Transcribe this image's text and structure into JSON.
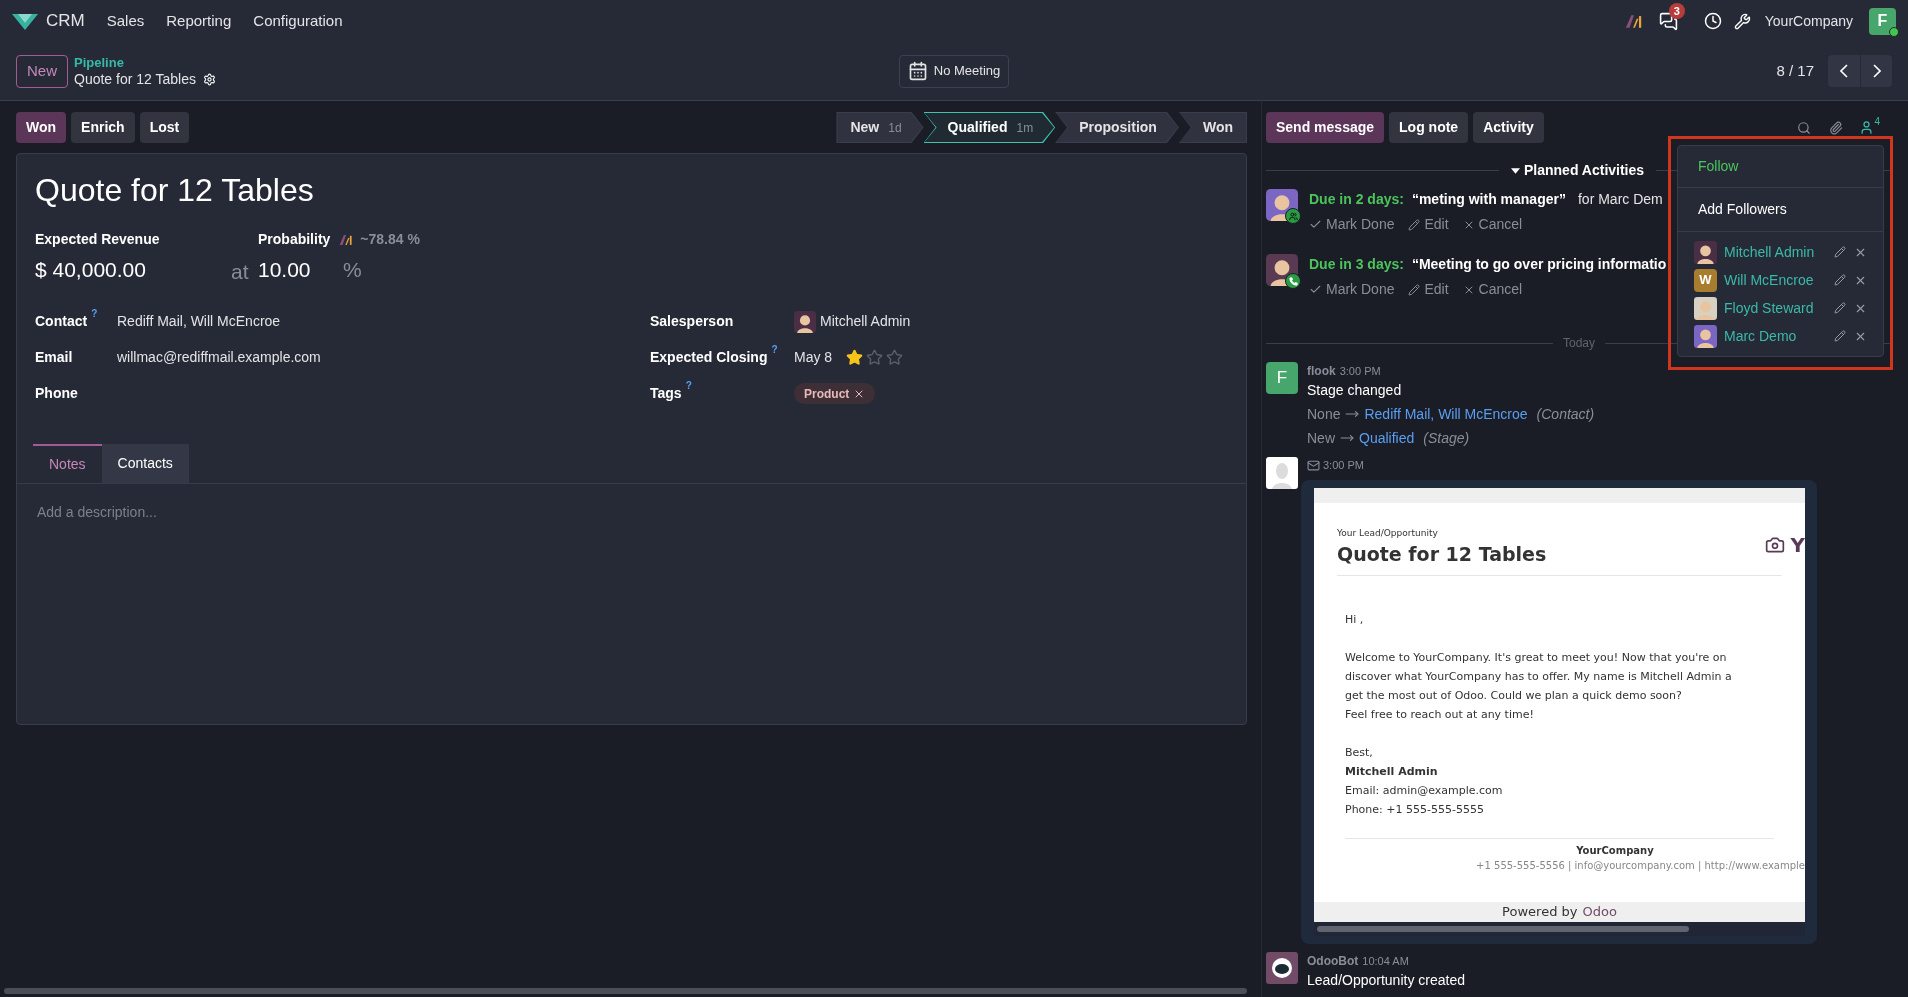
{
  "navbar": {
    "app": "CRM",
    "menus": [
      "Sales",
      "Reporting",
      "Configuration"
    ],
    "messages_badge": "3",
    "company": "YourCompany",
    "avatar": "F"
  },
  "control_panel": {
    "new_button": "New",
    "breadcrumb": "Pipeline",
    "record_title": "Quote for 12 Tables",
    "meeting_button": "No Meeting",
    "pager": "8 / 17"
  },
  "actions": [
    {
      "label": "Won",
      "primary": true
    },
    {
      "label": "Enrich",
      "primary": false
    },
    {
      "label": "Lost",
      "primary": false
    }
  ],
  "stages": [
    {
      "label": "New",
      "duration": "1d",
      "selected": false
    },
    {
      "label": "Qualified",
      "duration": "1m",
      "selected": true
    },
    {
      "label": "Proposition",
      "selected": false
    },
    {
      "label": "Won",
      "selected": false
    }
  ],
  "form": {
    "title": "Quote for 12 Tables",
    "expected_revenue_label": "Expected Revenue",
    "expected_revenue": "$ 40,000.00",
    "at": "at",
    "probability_label": "Probability",
    "ai_probability": "~78.84 %",
    "probability": "10.00",
    "percent": "%",
    "left_fields": [
      {
        "label": "Contact",
        "help": "?",
        "value": "Rediff Mail, Will McEncroe"
      },
      {
        "label": "Email",
        "value": "willmac@rediffmail.example.com"
      },
      {
        "label": "Phone"
      }
    ],
    "right_fields": [
      {
        "label": "Salesperson",
        "kind": "user",
        "value": "Mitchell Admin"
      },
      {
        "label": "Expected Closing",
        "help": "?",
        "kind": "date",
        "value": "May 8",
        "stars": 1
      },
      {
        "label": "Tags",
        "help": "?",
        "kind": "tags",
        "tags": [
          "Product"
        ]
      }
    ],
    "tabs": [
      {
        "label": "Notes",
        "selected": true
      },
      {
        "label": "Contacts",
        "selected": false
      }
    ],
    "notes_placeholder": "Add a description..."
  },
  "chatter": {
    "buttons": [
      {
        "label": "Send message",
        "primary": true
      },
      {
        "label": "Log note",
        "primary": false
      },
      {
        "label": "Activity",
        "primary": false
      }
    ],
    "followers_count": "4",
    "planned_heading": "Planned Activities",
    "activities": [
      {
        "kind": "meeting",
        "due": "Due in 2 days:",
        "summary": "“meting with manager”",
        "assigned": "for Marc Dem",
        "actions": [
          "Mark Done",
          "Edit",
          "Cancel"
        ]
      },
      {
        "kind": "call",
        "due": "Due in 3 days:",
        "summary": "“Meeting to go over pricing informatio",
        "actions": [
          "Mark Done",
          "Edit",
          "Cancel"
        ]
      }
    ],
    "today": "Today",
    "messages": [
      {
        "kind": "tracking",
        "author": "flook",
        "avatar": "F",
        "time": "3:00 PM",
        "title": "Stage changed",
        "changes": [
          {
            "old": "None",
            "new": "Rediff Mail, Will McEncroe",
            "field": "(Contact)"
          },
          {
            "old": "New",
            "new": "Qualified",
            "field": "(Stage)"
          }
        ]
      },
      {
        "kind": "email",
        "time": "3:00 PM",
        "email": {
          "subtitle": "Your Lead/Opportunity",
          "title": "Quote for 12 Tables",
          "logo_letter": "Y",
          "greeting": "Hi ,",
          "paragraph": [
            "Welcome to YourCompany. It's great to meet you! Now that you're on",
            "discover what YourCompany has to offer. My name is Mitchell Admin a",
            "get the most out of Odoo. Could we plan a quick demo soon?",
            "Feel free to reach out at any time!"
          ],
          "closing": "Best,",
          "signer": "Mitchell Admin",
          "contact_lines": [
            "Email: admin@example.com",
            "Phone: +1 555-555-5555"
          ],
          "footer_company": "YourCompany",
          "footer_line": "+1 555-555-5556 | info@yourcompany.com | http://www.example",
          "powered_by": "Powered by",
          "powered_link": "Odoo"
        }
      },
      {
        "kind": "note",
        "author": "OdooBot",
        "time": "10:04 AM",
        "body": "Lead/Opportunity created"
      }
    ]
  },
  "followers_menu": {
    "follow": "Follow",
    "add": "Add Followers",
    "followers": [
      {
        "name": "Mitchell Admin"
      },
      {
        "name": "Will McEncroe",
        "initial": "W"
      },
      {
        "name": "Floyd Steward"
      },
      {
        "name": "Marc Demo"
      }
    ]
  }
}
